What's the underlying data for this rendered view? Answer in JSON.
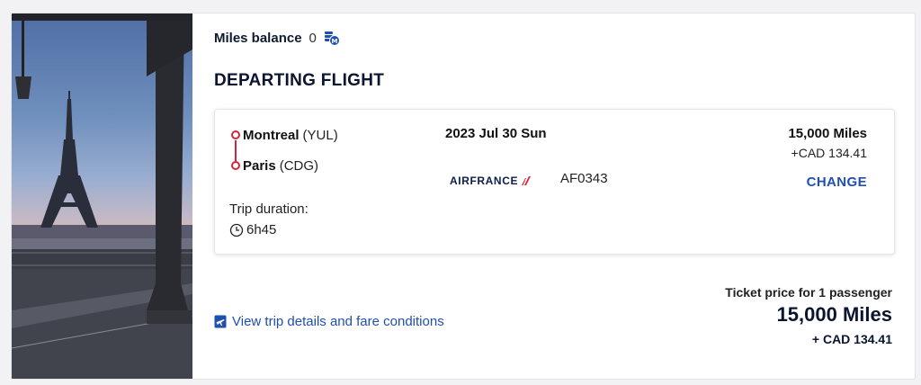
{
  "miles_balance": {
    "label": "Miles balance",
    "value": "0",
    "icon": "miles-wallet-icon"
  },
  "section_title": "DEPARTING FLIGHT",
  "flight": {
    "origin": {
      "city": "Montreal",
      "code": "(YUL)"
    },
    "destination": {
      "city": "Paris",
      "code": "(CDG)"
    },
    "trip_duration_label": "Trip duration:",
    "duration": "6h45",
    "date": "2023 Jul 30 Sun",
    "airline": "AIRFRANCE",
    "flight_number": "AF0343",
    "price_miles": "15,000 Miles",
    "price_cad": "+CAD 134.41",
    "change_label": "CHANGE"
  },
  "footer": {
    "view_link": "View trip details and fare conditions",
    "ticket_price_label": "Ticket price for 1 passenger",
    "ticket_miles": "15,000 Miles",
    "ticket_cad": "+ CAD 134.41"
  },
  "colors": {
    "accent_blue": "#1f4fb0",
    "route_red": "#d2263b",
    "navy": "#0b1530"
  }
}
